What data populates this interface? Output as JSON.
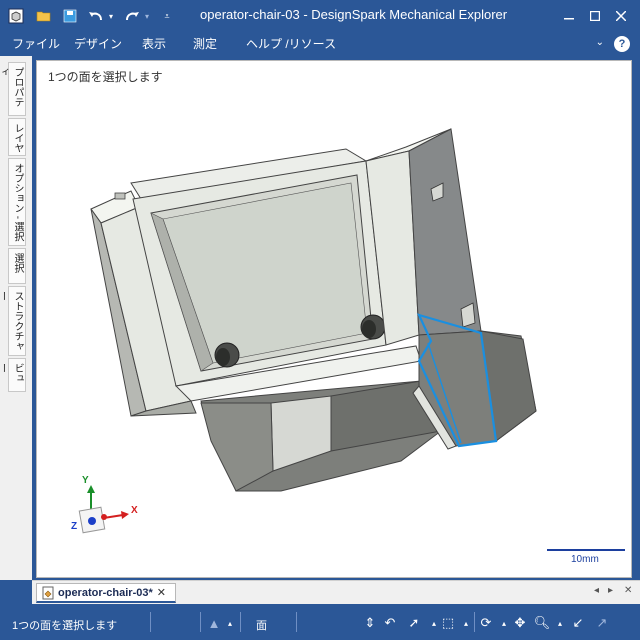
{
  "window": {
    "title": "operator-chair-03 - DesignSpark Mechanical Explorer"
  },
  "quick_access": {
    "icons": [
      "app-icon",
      "open-icon",
      "save-icon",
      "undo-icon",
      "redo-icon",
      "customize-icon"
    ]
  },
  "menu": {
    "items": [
      "ファイル",
      "デザイン",
      "表示",
      "測定",
      "ヘルプ /リソース"
    ],
    "help_glyph": "?"
  },
  "side_tabs": [
    "プロパティ",
    "レイヤ",
    "オプション - 選択",
    "選択",
    "ストラクチャー",
    "ビュー"
  ],
  "viewport": {
    "hint": "1つの面を選択します",
    "scale_label": "10mm",
    "axes": {
      "x": "X",
      "y": "Y",
      "z": "Z"
    }
  },
  "doc_tab": {
    "label": "operator-chair-03*",
    "close": "✕"
  },
  "status": {
    "text": "1つの面を選択します",
    "face_label": "面"
  },
  "colors": {
    "chrome": "#2b5797",
    "model_light": "#e9ece7",
    "model_dark": "#7d7f7b",
    "selection": "#1a8fe0"
  }
}
